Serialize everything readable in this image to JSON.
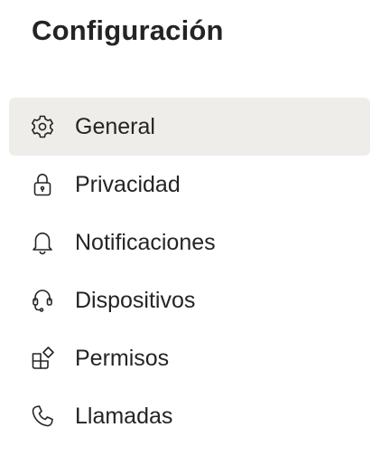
{
  "page": {
    "title": "Configuración"
  },
  "menu": {
    "items": [
      {
        "label": "General",
        "icon": "gear-icon",
        "selected": true
      },
      {
        "label": "Privacidad",
        "icon": "lock-icon",
        "selected": false
      },
      {
        "label": "Notificaciones",
        "icon": "bell-icon",
        "selected": false
      },
      {
        "label": "Dispositivos",
        "icon": "headset-icon",
        "selected": false
      },
      {
        "label": "Permisos",
        "icon": "apps-icon",
        "selected": false
      },
      {
        "label": "Llamadas",
        "icon": "phone-icon",
        "selected": false
      }
    ]
  },
  "colors": {
    "selected_background": "#efedea",
    "text": "#242424"
  }
}
